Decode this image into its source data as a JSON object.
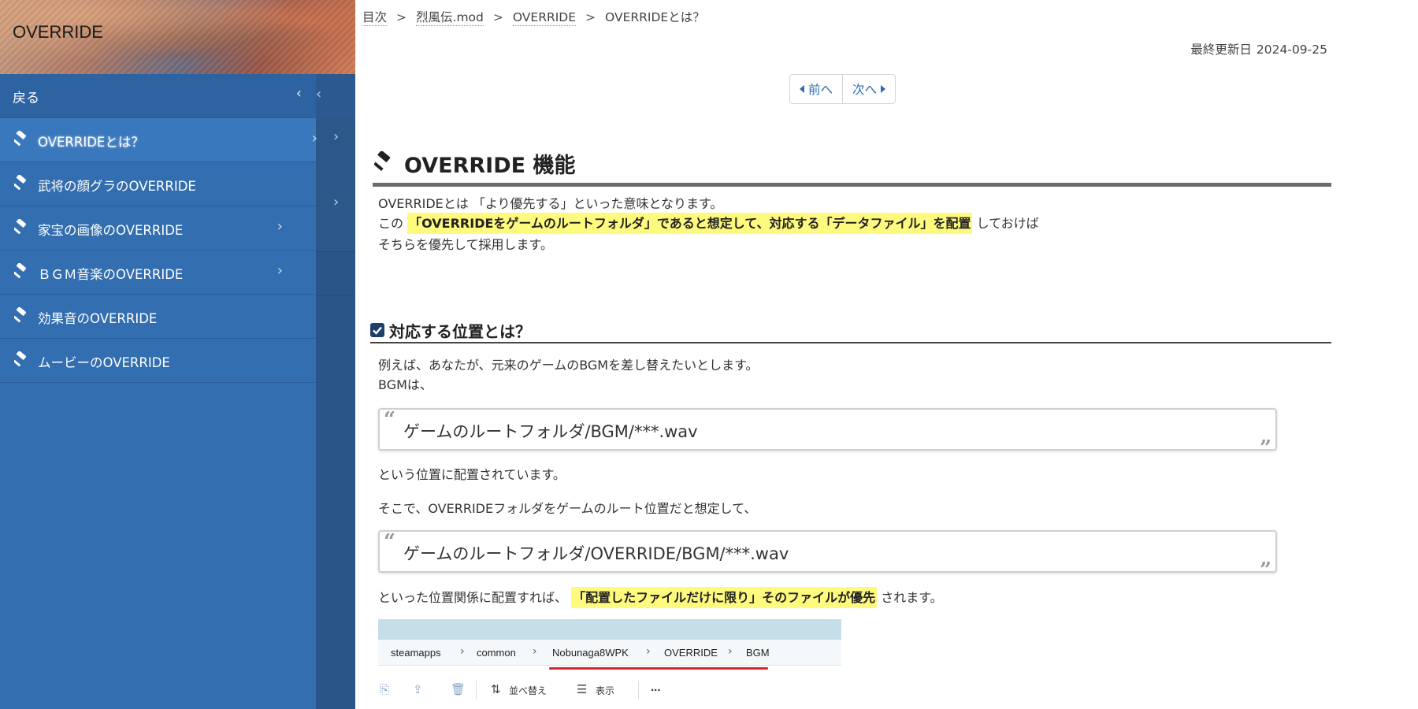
{
  "colors": {
    "sidebar_bg": "#336eb0",
    "sidebar_active": "#3a78bd",
    "link": "#2d6ab2",
    "highlight": "#fdfa7e",
    "heading_rule": "#6b6b6b",
    "red_underline": "#d5262f"
  },
  "sidebar": {
    "title": "OVERRIDE",
    "back_label": "戻る",
    "back_icon": "chevron-left-icon",
    "items": [
      {
        "label": "OVERRIDEとは？",
        "icon": "hammer-icon",
        "active": true,
        "has_children": true
      },
      {
        "label": "武将の顔グラのOVERRIDE",
        "icon": "hammer-icon",
        "active": false,
        "has_children": false
      },
      {
        "label": "家宝の画像のOVERRIDE",
        "icon": "hammer-icon",
        "active": false,
        "has_children": true
      },
      {
        "label": "ＢＧＭ音楽のOVERRIDE",
        "icon": "hammer-icon",
        "active": false,
        "has_children": true
      },
      {
        "label": "効果音のOVERRIDE",
        "icon": "hammer-icon",
        "active": false,
        "has_children": false
      },
      {
        "label": "ムービーのOVERRIDE",
        "icon": "hammer-icon",
        "active": false,
        "has_children": false
      }
    ]
  },
  "breadcrumb": {
    "items": [
      "目次",
      "烈風伝.mod",
      "OVERRIDE"
    ],
    "current": "OVERRIDEとは？",
    "separator": ">"
  },
  "updated": {
    "label": "最終更新日",
    "date": "2024-09-25"
  },
  "pager": {
    "prev": "前へ",
    "next": "次へ"
  },
  "section1": {
    "heading": "OVERRIDE 機能",
    "line1": "OVERRIDEとは 「より優先する」といった意味となります。",
    "line2_pre": "この",
    "line2_highlight": "「OVERRIDEをゲームのルートフォルダ」であると想定して、対応する「データファイル」を配置",
    "line2_post": "しておけば",
    "line3": "そちらを優先して採用します。"
  },
  "section2": {
    "heading": "対応する位置とは？",
    "p1": "例えば、あなたが、元来のゲームのBGMを差し替えたいとします。",
    "p2": "BGMは、",
    "quote1": "ゲームのルートフォルダ/BGM/***.wav",
    "p3": "という位置に配置されています。",
    "p4": "そこで、OVERRIDEフォルダをゲームのルート位置だと想定して、",
    "quote2": "ゲームのルートフォルダ/OVERRIDE/BGM/***.wav",
    "p5_pre": "といった位置関係に配置すれば、",
    "p5_highlight": "「配置したファイルだけに限り」そのファイルが優先",
    "p5_post": "されます。"
  },
  "explorer": {
    "path": [
      "steamapps",
      "common",
      "Nobunaga8WPK",
      "OVERRIDE",
      "BGM"
    ],
    "toolbar": {
      "sort": "並べ替え",
      "view": "表示",
      "more": "..."
    }
  }
}
